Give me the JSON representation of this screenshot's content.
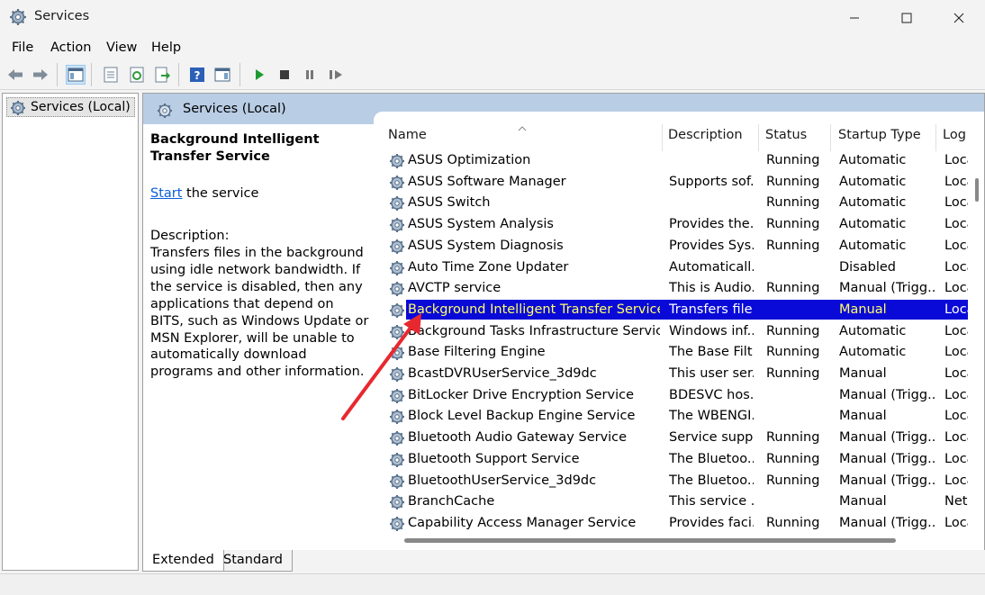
{
  "window": {
    "title": "Services"
  },
  "menu": {
    "items": [
      "File",
      "Action",
      "View",
      "Help"
    ]
  },
  "tree": {
    "root_label": "Services (Local)"
  },
  "pane": {
    "header": "Services (Local)"
  },
  "details": {
    "service_title": "Background Intelligent Transfer Service",
    "action_link": "Start",
    "action_suffix": " the service",
    "description_label": "Description:",
    "description_text": "Transfers files in the background using idle network bandwidth. If the service is disabled, then any applications that depend on BITS, such as Windows Update or MSN Explorer, will be unable to automatically download programs and other information."
  },
  "columns": {
    "name": "Name",
    "description": "Description",
    "status": "Status",
    "startup": "Startup Type",
    "log": "Log"
  },
  "services": [
    {
      "name": "ASUS Optimization",
      "description": "",
      "status": "Running",
      "startup": "Automatic",
      "log": "Loca"
    },
    {
      "name": "ASUS Software Manager",
      "description": "Supports sof...",
      "status": "Running",
      "startup": "Automatic",
      "log": "Loca"
    },
    {
      "name": "ASUS Switch",
      "description": "",
      "status": "Running",
      "startup": "Automatic",
      "log": "Loca"
    },
    {
      "name": "ASUS System Analysis",
      "description": "Provides the...",
      "status": "Running",
      "startup": "Automatic",
      "log": "Loca"
    },
    {
      "name": "ASUS System Diagnosis",
      "description": "Provides Sys...",
      "status": "Running",
      "startup": "Automatic",
      "log": "Loca"
    },
    {
      "name": "Auto Time Zone Updater",
      "description": "Automaticall...",
      "status": "",
      "startup": "Disabled",
      "log": "Loca"
    },
    {
      "name": "AVCTP service",
      "description": "This is Audio...",
      "status": "Running",
      "startup": "Manual (Trigg...",
      "log": "Loca"
    },
    {
      "name": "Background Intelligent Transfer Service",
      "description": "Transfers file...",
      "status": "",
      "startup": "Manual",
      "log": "Loca"
    },
    {
      "name": "Background Tasks Infrastructure Service",
      "description": "Windows inf...",
      "status": "Running",
      "startup": "Automatic",
      "log": "Loca"
    },
    {
      "name": "Base Filtering Engine",
      "description": "The Base Filt...",
      "status": "Running",
      "startup": "Automatic",
      "log": "Loca"
    },
    {
      "name": "BcastDVRUserService_3d9dc",
      "description": "This user ser...",
      "status": "Running",
      "startup": "Manual",
      "log": "Loca"
    },
    {
      "name": "BitLocker Drive Encryption Service",
      "description": "BDESVC hos...",
      "status": "",
      "startup": "Manual (Trigg...",
      "log": "Loca"
    },
    {
      "name": "Block Level Backup Engine Service",
      "description": "The WBENGI...",
      "status": "",
      "startup": "Manual",
      "log": "Loca"
    },
    {
      "name": "Bluetooth Audio Gateway Service",
      "description": "Service supp...",
      "status": "Running",
      "startup": "Manual (Trigg...",
      "log": "Loca"
    },
    {
      "name": "Bluetooth Support Service",
      "description": "The Bluetoo...",
      "status": "Running",
      "startup": "Manual (Trigg...",
      "log": "Loca"
    },
    {
      "name": "BluetoothUserService_3d9dc",
      "description": "The Bluetoo...",
      "status": "Running",
      "startup": "Manual (Trigg...",
      "log": "Loca"
    },
    {
      "name": "BranchCache",
      "description": "This service ...",
      "status": "",
      "startup": "Manual",
      "log": "Net"
    },
    {
      "name": "Capability Access Manager Service",
      "description": "Provides faci...",
      "status": "Running",
      "startup": "Manual (Trigg...",
      "log": "Loca"
    }
  ],
  "selected_index": 7,
  "tabs": {
    "extended": "Extended",
    "standard": "Standard"
  },
  "colors": {
    "selection": "#0a0ad8",
    "selection_text": "#ffff66",
    "header_band": "#b9cde5",
    "annotation_arrow": "#e8282f"
  }
}
